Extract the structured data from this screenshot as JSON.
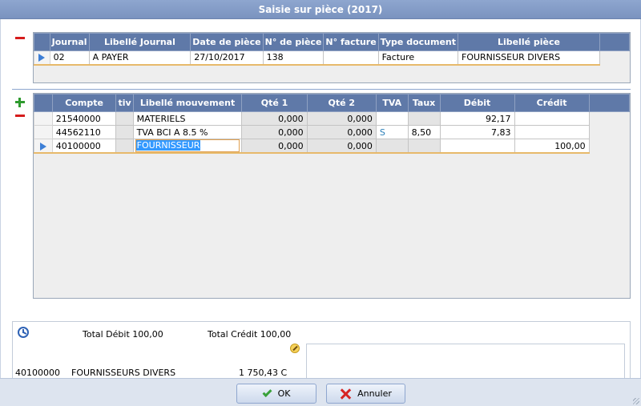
{
  "window": {
    "title": "Saisie sur pièce (2017)"
  },
  "piece_grid": {
    "headers": [
      "Journal",
      "Libellé Journal",
      "Date de pièce",
      "N° de pièce",
      "N° facture",
      "Type document",
      "Libellé pièce"
    ],
    "row": {
      "journal": "02",
      "libelle_journal": "A PAYER",
      "date": "27/10/2017",
      "numero": "138",
      "facture": "",
      "type": "Facture",
      "libelle": "FOURNISSEUR DIVERS"
    }
  },
  "movements_grid": {
    "headers": [
      "Compte",
      "tiv",
      "Libellé mouvement",
      "Qté 1",
      "Qté 2",
      "TVA",
      "Taux",
      "Débit",
      "Crédit"
    ],
    "rows": [
      {
        "compte": "21540000",
        "tiv": "",
        "libelle": "MATERIELS",
        "qte1": "0,000",
        "qte2": "0,000",
        "tva": "",
        "taux": "",
        "debit": "92,17",
        "credit": ""
      },
      {
        "compte": "44562110",
        "tiv": "",
        "libelle": "TVA BCI A 8.5 %",
        "qte1": "0,000",
        "qte2": "0,000",
        "tva": "S",
        "taux": "8,50",
        "debit": "7,83",
        "credit": ""
      },
      {
        "compte": "40100000",
        "tiv": "",
        "libelle": "FOURNISSEUR",
        "qte1": "0,000",
        "qte2": "0,000",
        "tva": "",
        "taux": "",
        "debit": "",
        "credit": "100,00"
      }
    ]
  },
  "totals": {
    "debit": "Total Débit 100,00",
    "credit": "Total Crédit 100,00",
    "account_code": "40100000",
    "account_name": "FOURNISSEURS DIVERS",
    "account_balance": "1 750,43 C"
  },
  "footer": {
    "ok_label": "OK",
    "cancel_label": "Annuler"
  },
  "colors": {
    "header_bg": "#5f79a8",
    "title_bg": "#8ea6cf",
    "current_row_underline": "#e7b96a"
  }
}
